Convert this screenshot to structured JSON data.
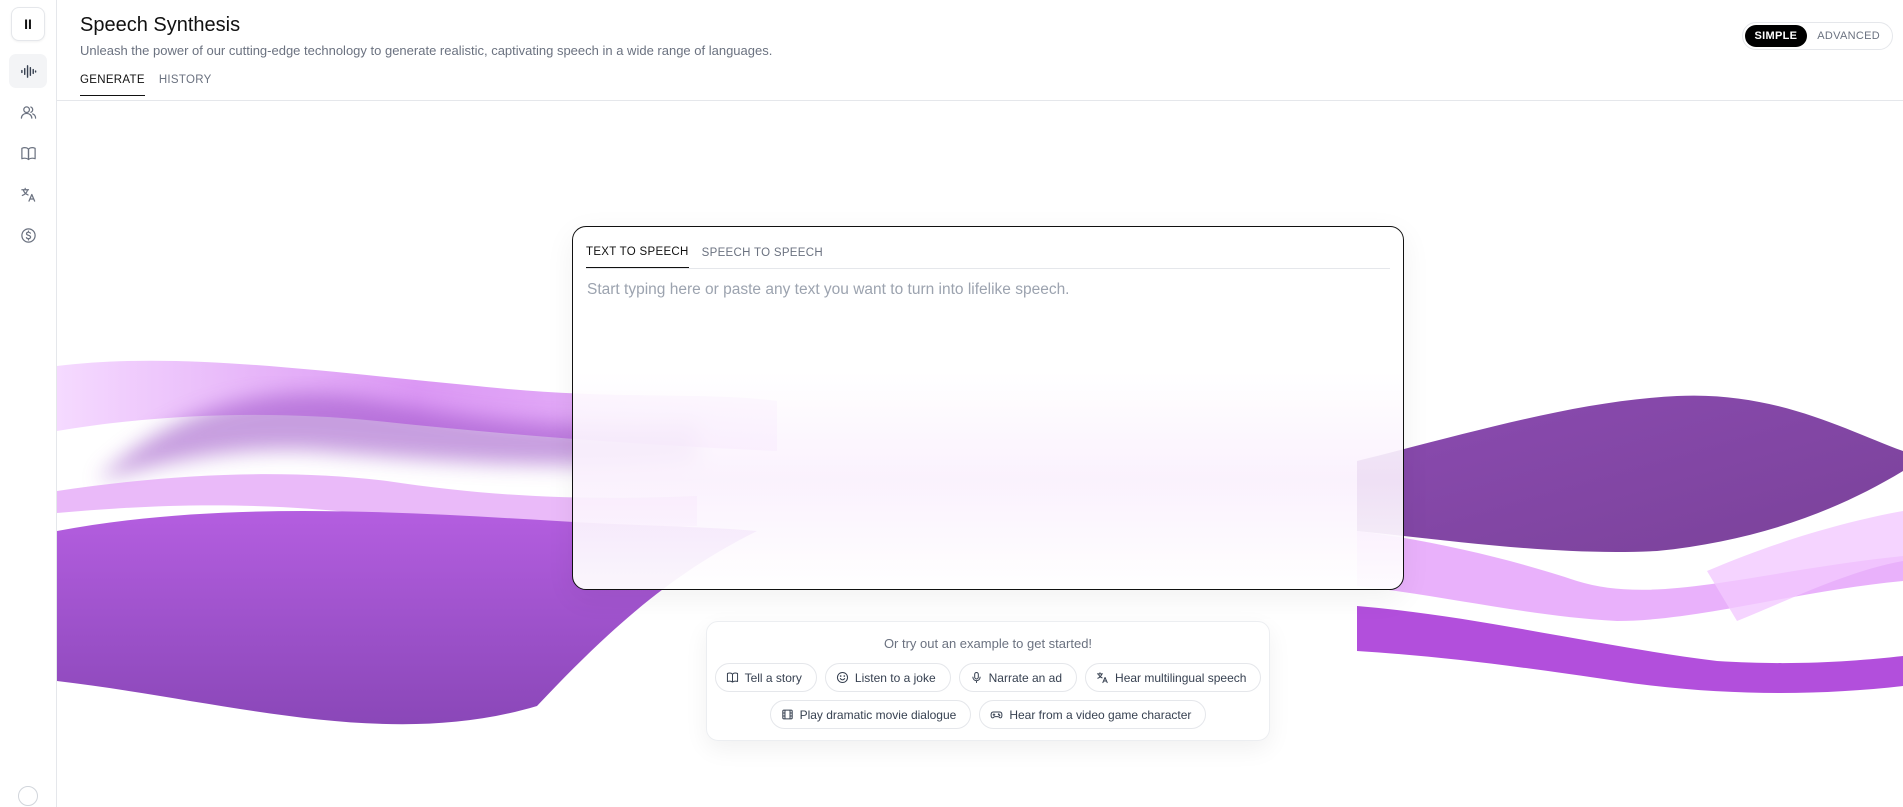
{
  "app": {
    "logo_glyph": "II",
    "title": "Speech Synthesis",
    "subtitle": "Unleash the power of our cutting-edge technology to generate realistic, captivating speech in a wide range of languages."
  },
  "sidebar": {
    "items": [
      {
        "name": "waveform-icon",
        "active": true
      },
      {
        "name": "users-icon",
        "active": false
      },
      {
        "name": "book-icon",
        "active": false
      },
      {
        "name": "translate-icon",
        "active": false
      },
      {
        "name": "dollar-coin-icon",
        "active": false
      }
    ]
  },
  "header": {
    "tabs": [
      {
        "label": "GENERATE",
        "active": true
      },
      {
        "label": "HISTORY",
        "active": false
      }
    ],
    "mode": {
      "simple": "SIMPLE",
      "advanced": "ADVANCED",
      "selected": "SIMPLE"
    }
  },
  "editor": {
    "tabs": [
      {
        "label": "TEXT TO SPEECH",
        "active": true
      },
      {
        "label": "SPEECH TO SPEECH",
        "active": false
      }
    ],
    "value": "",
    "placeholder": "Start typing here or paste any text you want to turn into lifelike speech."
  },
  "examples": {
    "caption": "Or try out an example to get started!",
    "chips": [
      {
        "label": "Tell a story",
        "icon": "book-icon"
      },
      {
        "label": "Listen to a joke",
        "icon": "smile-icon"
      },
      {
        "label": "Narrate an ad",
        "icon": "microphone-icon"
      },
      {
        "label": "Hear multilingual speech",
        "icon": "translate-icon"
      },
      {
        "label": "Play dramatic movie dialogue",
        "icon": "film-icon"
      },
      {
        "label": "Hear from a video game character",
        "icon": "gamepad-icon"
      }
    ]
  },
  "colors": {
    "accent": "#000000",
    "wave_dark": "#7b3fa0",
    "wave_mid": "#b04fdc",
    "wave_light": "#e8b5fb"
  }
}
